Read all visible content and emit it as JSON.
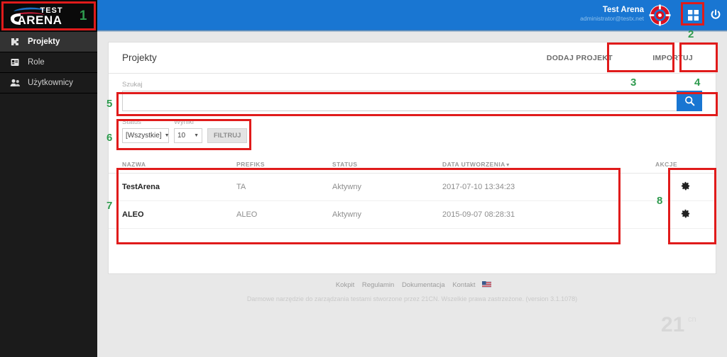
{
  "brand": {
    "logo_text_top": "TEST",
    "logo_text_main": "ARENA",
    "header_blue": "#1976D2",
    "annotation_red": "#E01B1B",
    "annotation_green": "#2E9B4E"
  },
  "sidebar": {
    "items": [
      {
        "label": "Projekty",
        "icon": "puzzle-icon",
        "active": true
      },
      {
        "label": "Role",
        "icon": "id-card-icon",
        "active": false
      },
      {
        "label": "Użytkownicy",
        "icon": "users-icon",
        "active": false
      }
    ]
  },
  "topbar": {
    "user_name": "Test Arena",
    "user_email": "administrator@testx.net",
    "grid_icon": "grid-apps-icon",
    "power_icon": "power-logout-icon",
    "cursor_icon": "target-cursor-icon"
  },
  "main": {
    "page_title": "Projekty",
    "add_project_label": "DODAJ PROJEKT",
    "import_label": "IMPORTUJ"
  },
  "search": {
    "label": "Szukaj",
    "value": "",
    "placeholder": "",
    "button_icon": "search-icon"
  },
  "filters": {
    "status_label": "Status",
    "status_value": "[Wszystkie]",
    "results_label": "Wyniki",
    "results_value": "10",
    "filter_button": "FILTRUJ"
  },
  "table": {
    "columns": [
      {
        "key": "nazwa",
        "label": "NAZWA"
      },
      {
        "key": "prefiks",
        "label": "PREFIKS"
      },
      {
        "key": "status",
        "label": "STATUS"
      },
      {
        "key": "data",
        "label": "DATA UTWORZENIA",
        "sorted": "desc",
        "sort_glyph": "▼"
      },
      {
        "key": "akcje",
        "label": "AKCJE"
      }
    ],
    "rows": [
      {
        "nazwa": "TestArena",
        "prefiks": "TA",
        "status": "Aktywny",
        "data": "2017-07-10 13:34:23",
        "action_icon": "gear-icon"
      },
      {
        "nazwa": "ALEO",
        "prefiks": "ALEO",
        "status": "Aktywny",
        "data": "2015-09-07 08:28:31",
        "action_icon": "gear-icon"
      }
    ]
  },
  "footer": {
    "links": [
      "Kokpit",
      "Regulamin",
      "Dokumentacja",
      "Kontakt"
    ],
    "flag_icon": "flag-icon",
    "note": "Darmowe narzędzie do zarządzania testami stworzone przez 21CN. Wszelkie prawa zastrzeżone. (version 3.1.1078)",
    "watermark": "21cn"
  },
  "annotations": {
    "numbers": [
      "1",
      "2",
      "3",
      "4",
      "5",
      "6",
      "7",
      "8"
    ]
  }
}
